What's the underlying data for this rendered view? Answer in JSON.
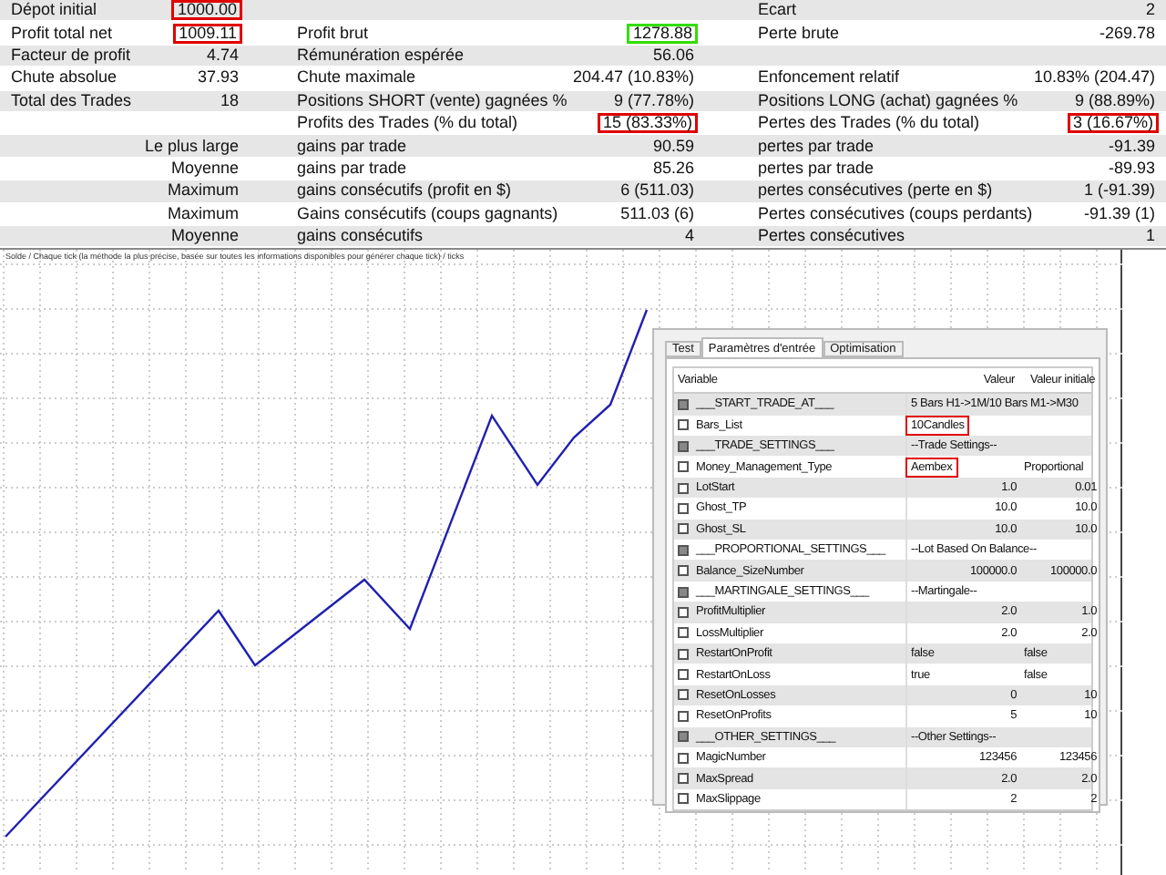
{
  "stats": [
    {
      "label_1": "Dépot initial",
      "value_1": {
        "text": "1000.00",
        "color": "#e00000"
      },
      "label_3": "Ecart",
      "value_3": "2"
    },
    {
      "label_1": "Profit total net",
      "value_1": {
        "text": "1009.11",
        "color": "#e00000"
      },
      "label_2": "Profit brut",
      "value_2": {
        "text": "1278.88",
        "color": "#33dd00"
      },
      "label_3": "Perte brute",
      "value_3": "-269.78"
    },
    {
      "label_1": "Facteur de profit",
      "value_1": "4.74",
      "label_2": "Rémunération espérée",
      "value_2": "56.06"
    },
    {
      "label_1": "Chute absolue",
      "value_1": "37.93",
      "label_2": "Chute maximale",
      "value_2": "204.47 (10.83%)",
      "label_3": "Enfoncement relatif",
      "value_3": "10.83% (204.47)"
    },
    {
      "label_1": "Total des Trades",
      "value_1": "18",
      "label_2": "Positions SHORT (vente) gagnées %",
      "value_2": "9 (77.78%)",
      "label_3": "Positions LONG (achat) gagnées %",
      "value_3": "9 (88.89%)"
    },
    {
      "label_2": "Profits des Trades (% du total)",
      "value_2": {
        "text": "15 (83.33%)",
        "color": "#e00000"
      },
      "label_3": "Pertes des Trades (% du total)",
      "value_3": {
        "text": "3 (16.67%)",
        "color": "#e00000"
      }
    },
    {
      "value_1": "Le plus large",
      "label_2": "gains par trade",
      "value_2": "90.59",
      "label_3": "pertes par trade",
      "value_3": "-91.39"
    },
    {
      "value_1": "Moyenne",
      "label_2": "gains par trade",
      "value_2": "85.26",
      "label_3": "pertes par trade",
      "value_3": "-89.93"
    },
    {
      "value_1": "Maximum",
      "label_2": "gains consécutifs (profit en $)",
      "value_2": "6 (511.03)",
      "label_3": "pertes consécutives (perte en $)",
      "value_3": "1 (-91.39)"
    },
    {
      "value_1": "Maximum",
      "label_2": "Gains consécutifs (coups gagnants)",
      "value_2": "511.03 (6)",
      "label_3": "Pertes consécutives (coups perdants)",
      "value_3": "-91.39 (1)"
    },
    {
      "value_1": "Moyenne",
      "label_2": "gains consécutifs",
      "value_2": "4",
      "label_3": "Pertes consécutives",
      "value_3": "1"
    }
  ],
  "chart": {
    "caption": "Solde / Chaque tick (la méthode la plus précise, basée sur toutes les informations disponibles pour générer chaque tick) / ticks"
  },
  "params_window": {
    "tabs": [
      {
        "label": "Test",
        "selected": false
      },
      {
        "label": "Paramètres d'entrée",
        "selected": true
      },
      {
        "label": "Optimisation",
        "selected": false
      }
    ],
    "columns": [
      "Variable",
      "Valeur",
      "Valeur initiale"
    ],
    "rows": [
      {
        "kind": "section",
        "checked": false,
        "name": "___START_TRADE_AT___",
        "value": "5 Bars H1->1M/10 Bars M1->M30"
      },
      {
        "kind": "text",
        "checked": false,
        "name": "Bars_List",
        "value": "10Candles",
        "boxed": true
      },
      {
        "kind": "section",
        "checked": false,
        "name": "___TRADE_SETTINGS___",
        "value": "--Trade Settings--"
      },
      {
        "kind": "text",
        "checked": false,
        "name": "Money_Management_Type",
        "value": "Aembex",
        "initial": "Proportional",
        "boxed": true
      },
      {
        "kind": "number",
        "checked": false,
        "name": "LotStart",
        "value": "1.0",
        "initial": "0.01"
      },
      {
        "kind": "number",
        "checked": false,
        "name": "Ghost_TP",
        "value": "10.0",
        "initial": "10.0"
      },
      {
        "kind": "number",
        "checked": false,
        "name": "Ghost_SL",
        "value": "10.0",
        "initial": "10.0"
      },
      {
        "kind": "section",
        "checked": false,
        "name": "___PROPORTIONAL_SETTINGS___",
        "value": "--Lot Based On Balance--"
      },
      {
        "kind": "number",
        "checked": false,
        "name": "Balance_SizeNumber",
        "value": "100000.0",
        "initial": "100000.0"
      },
      {
        "kind": "section",
        "checked": false,
        "name": "___MARTINGALE_SETTINGS___",
        "value": "--Martingale--"
      },
      {
        "kind": "number",
        "checked": false,
        "name": "ProfitMultiplier",
        "value": "2.0",
        "initial": "1.0"
      },
      {
        "kind": "number",
        "checked": false,
        "name": "LossMultiplier",
        "value": "2.0",
        "initial": "2.0"
      },
      {
        "kind": "text",
        "checked": false,
        "name": "RestartOnProfit",
        "value": "false",
        "initial": "false"
      },
      {
        "kind": "text",
        "checked": false,
        "name": "RestartOnLoss",
        "value": "true",
        "initial": "false"
      },
      {
        "kind": "number",
        "checked": false,
        "name": "ResetOnLosses",
        "value": "0",
        "initial": "10"
      },
      {
        "kind": "number",
        "checked": false,
        "name": "ResetOnProfits",
        "value": "5",
        "initial": "10"
      },
      {
        "kind": "section",
        "checked": false,
        "name": "___OTHER_SETTINGS___",
        "value": "--Other Settings--"
      },
      {
        "kind": "number",
        "checked": false,
        "name": "MagicNumber",
        "value": "123456",
        "initial": "123456"
      },
      {
        "kind": "number",
        "checked": false,
        "name": "MaxSpread",
        "value": "2.0",
        "initial": "2.0"
      },
      {
        "kind": "number",
        "checked": false,
        "name": "MaxSlippage",
        "value": "2",
        "initial": "2"
      }
    ]
  }
}
